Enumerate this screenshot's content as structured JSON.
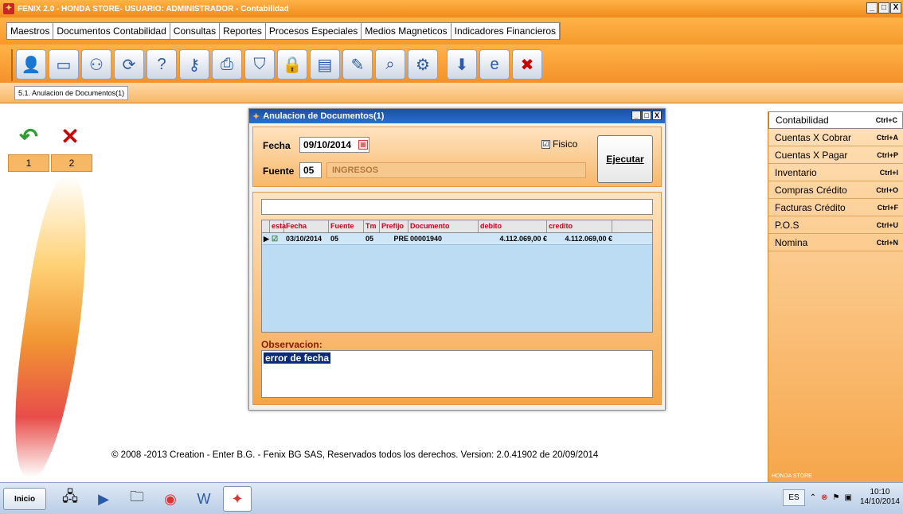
{
  "window": {
    "title": "FENIX 2.0 - HONDA STORE- USUARIO: ADMINISTRADOR  - Contabilidad",
    "controls": [
      "_",
      "□",
      "X"
    ]
  },
  "menu": [
    "Maestros",
    "Documentos Contabilidad",
    "Consultas",
    "Reportes",
    "Procesos Especiales",
    "Medios Magneticos",
    "Indicadores Financieros"
  ],
  "toolbar": {
    "icons": [
      "user-icon",
      "scanner-icon",
      "users-network-icon",
      "refresh-icon",
      "help-icon",
      "keys-icon",
      "printer-icon",
      "shield-icon",
      "lock-icon",
      "notepad-icon",
      "edit-icon",
      "search-icon",
      "settings-icon",
      "download-icon",
      "internet-explorer-icon",
      "close-app-icon"
    ]
  },
  "open_tab": "5.1. Anulacion de Documentos(1)",
  "left_panel": {
    "tabs": [
      "1",
      "2"
    ]
  },
  "dialog": {
    "title": "Anulacion de Documentos(1)",
    "fecha_label": "Fecha",
    "fecha_value": "09/10/2014",
    "fisico_label": "Fisico",
    "fisico_checked": "☑",
    "fuente_label": "Fuente",
    "fuente_code": "05",
    "fuente_desc": "INGRESOS",
    "ejecutar_label": "Ejecutar",
    "grid": {
      "columns": [
        "esta",
        "Fecha",
        "Fuente",
        "Tm",
        "Prefijo",
        "Documento",
        "debito",
        "credito"
      ],
      "rows": [
        {
          "esta": "☑",
          "fecha": "03/10/2014",
          "fuente": "05",
          "tm": "05",
          "prefijo": "PRE",
          "documento": "00001940",
          "debito": "4.112.069,00 €",
          "credito": "4.112.069,00 €"
        }
      ]
    },
    "observacion_label": "Observacion:",
    "observacion_value": "error de fecha"
  },
  "right_panel": {
    "items": [
      {
        "label": "Contabilidad",
        "shortcut": "Ctrl+C"
      },
      {
        "label": "Cuentas X Cobrar",
        "shortcut": "Ctrl+A"
      },
      {
        "label": "Cuentas X Pagar",
        "shortcut": "Ctrl+P"
      },
      {
        "label": "Inventario",
        "shortcut": "Ctrl+I"
      },
      {
        "label": "Compras  Crédito",
        "shortcut": "Ctrl+O"
      },
      {
        "label": "Facturas  Crédito",
        "shortcut": "Ctrl+F"
      },
      {
        "label": "P.O.S",
        "shortcut": "Ctrl+U"
      },
      {
        "label": "Nomina",
        "shortcut": "Ctrl+N"
      }
    ],
    "watermark": "HONDA STORE"
  },
  "footer": "© 2008 -2013 Creation - Enter B.G. - Fenix BG SAS, Reservados todos los derechos.   Version: 2.0.41902 de 20/09/2014",
  "taskbar": {
    "start_label": "Inicio",
    "lang": "ES",
    "time": "10:10",
    "date": "14/10/2014"
  }
}
